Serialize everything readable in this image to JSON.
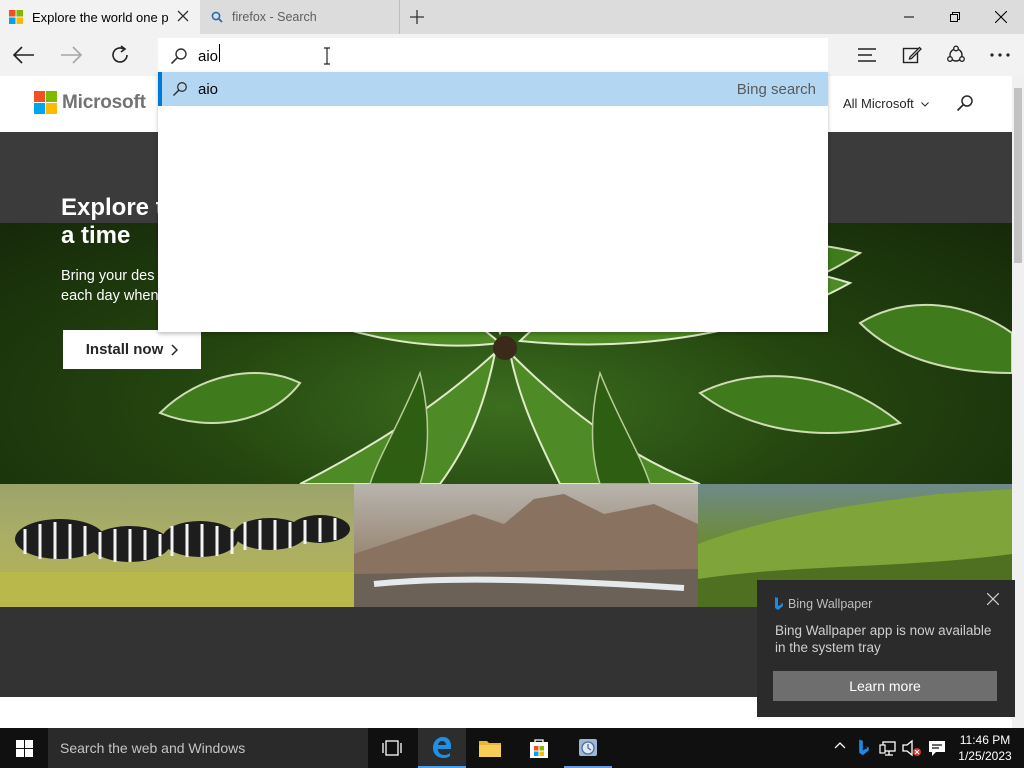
{
  "browser": {
    "tabs": [
      {
        "title": "Explore the world one p"
      },
      {
        "title": "firefox - Search"
      }
    ],
    "address": {
      "value": "aio"
    },
    "suggestion": {
      "query": "aio",
      "source": "Bing search"
    }
  },
  "page": {
    "brand": "Microsoft",
    "nav_all": "All Microsoft",
    "hero_title": "Explore th\na time",
    "hero_sub": "Bring your des\neach day when",
    "install_label": "Install now"
  },
  "toast": {
    "title": "Bing Wallpaper",
    "body": "Bing Wallpaper app is now available in the system tray",
    "button": "Learn more"
  },
  "taskbar": {
    "search_placeholder": "Search the web and Windows",
    "time": "11:46 PM",
    "date": "1/25/2023"
  },
  "colors": {
    "accent": "#0078d7",
    "suggestion_highlight": "#b3d7f3",
    "hero_dark": "#3b3b3b",
    "toast_bg": "#2b2b2b"
  }
}
